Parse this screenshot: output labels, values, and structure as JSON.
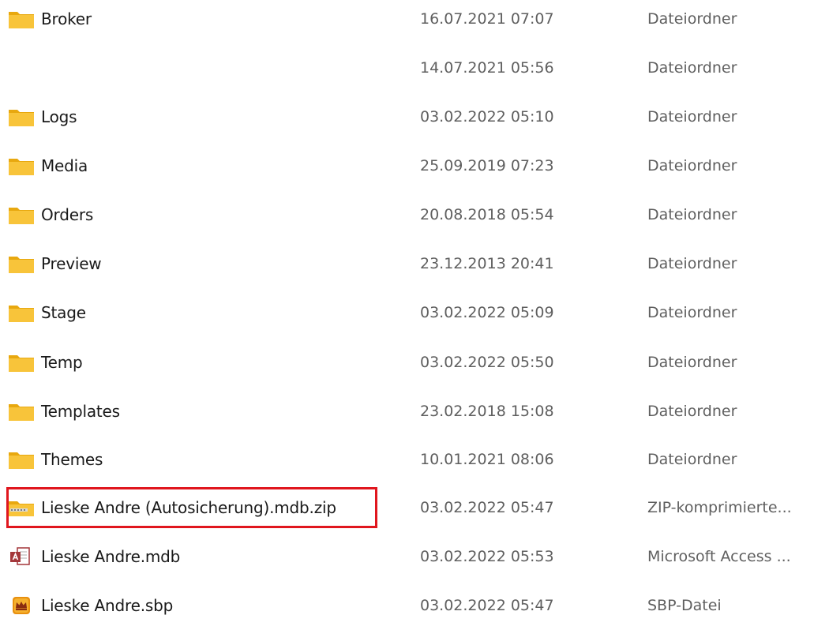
{
  "files": [
    {
      "name": "Broker",
      "date": "16.07.2021 07:07",
      "type": "Dateiordner",
      "icon": "folder-icon"
    },
    {
      "name": "",
      "date": "14.07.2021 05:56",
      "type": "Dateiordner",
      "icon": ""
    },
    {
      "name": "Logs",
      "date": "03.02.2022 05:10",
      "type": "Dateiordner",
      "icon": "folder-icon"
    },
    {
      "name": "Media",
      "date": "25.09.2019 07:23",
      "type": "Dateiordner",
      "icon": "folder-icon"
    },
    {
      "name": "Orders",
      "date": "20.08.2018 05:54",
      "type": "Dateiordner",
      "icon": "folder-icon"
    },
    {
      "name": "Preview",
      "date": "23.12.2013 20:41",
      "type": "Dateiordner",
      "icon": "folder-icon"
    },
    {
      "name": "Stage",
      "date": "03.02.2022 05:09",
      "type": "Dateiordner",
      "icon": "folder-icon"
    },
    {
      "name": "Temp",
      "date": "03.02.2022 05:50",
      "type": "Dateiordner",
      "icon": "folder-icon"
    },
    {
      "name": "Templates",
      "date": "23.02.2018 15:08",
      "type": "Dateiordner",
      "icon": "folder-icon"
    },
    {
      "name": "Themes",
      "date": "10.01.2021 08:06",
      "type": "Dateiordner",
      "icon": "folder-icon"
    },
    {
      "name": "Lieske Andre (Autosicherung).mdb.zip",
      "date": "03.02.2022 05:47",
      "type": "ZIP-komprimierte...",
      "icon": "zip-folder-icon"
    },
    {
      "name": "Lieske Andre.mdb",
      "date": "03.02.2022 05:53",
      "type": "Microsoft Access ...",
      "icon": "access-database-icon"
    },
    {
      "name": "Lieske Andre.sbp",
      "date": "03.02.2022 05:47",
      "type": "SBP-Datei",
      "icon": "sbp-file-icon"
    }
  ],
  "colors": {
    "folder": "#f8c43a",
    "folder_dark": "#e8a80f",
    "highlight": "#e0161e",
    "date_text": "#5f5f5f"
  }
}
